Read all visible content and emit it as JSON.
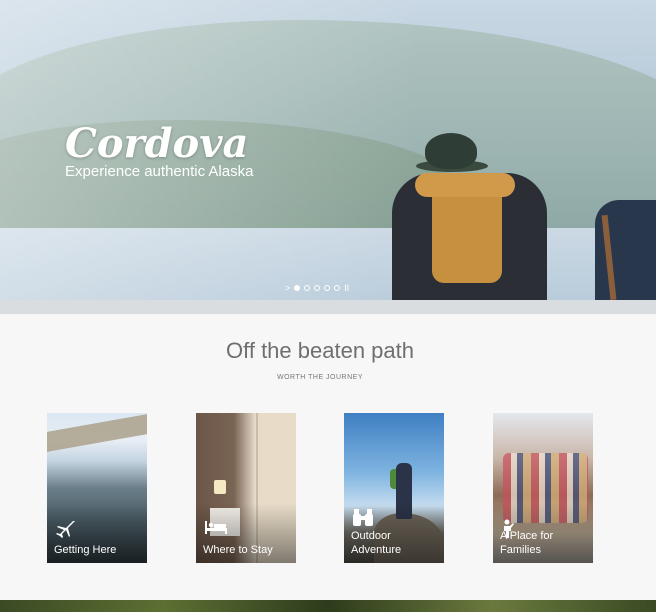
{
  "hero": {
    "title": "Cordova",
    "subtitle": "Experience authentic Alaska",
    "slider": {
      "next_glyph": ">",
      "pause_glyph": "II",
      "slide_count": 5,
      "active_index": 0
    }
  },
  "section": {
    "title": "Off the beaten path",
    "subtitle": "WORTH THE JOURNEY"
  },
  "cards": [
    {
      "label": "Getting Here",
      "icon": "airplane-icon"
    },
    {
      "label": "Where to Stay",
      "icon": "bed-icon"
    },
    {
      "label": "Outdoor Adventure",
      "icon": "binoculars-icon"
    },
    {
      "label": "A Place for Families",
      "icon": "family-icon"
    }
  ],
  "colors": {
    "background": "#f7f7f7",
    "band": "#d9dde0",
    "heading": "#6f6f6f"
  }
}
